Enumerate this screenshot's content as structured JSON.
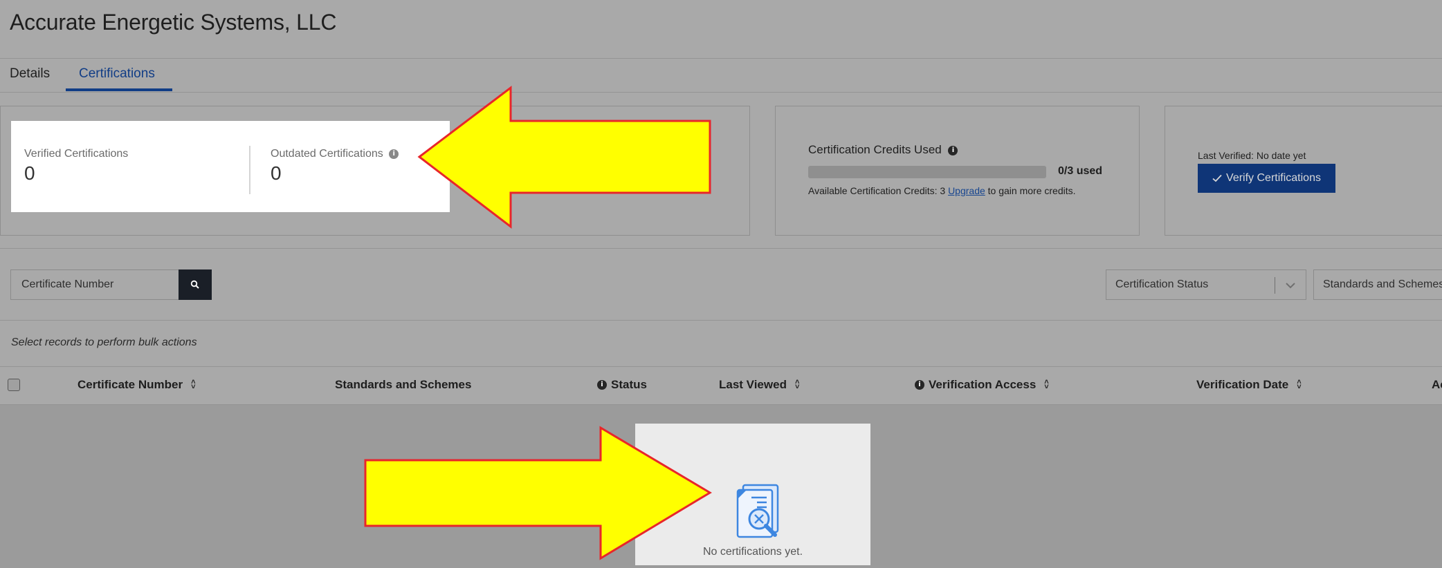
{
  "page": {
    "title": "Accurate Energetic Systems, LLC"
  },
  "tabs": [
    {
      "label": "Details",
      "active": false
    },
    {
      "label": "Certifications",
      "active": true
    }
  ],
  "stats": {
    "verified_label": "Verified Certifications",
    "verified_value": "0",
    "outdated_label": "Outdated Certifications",
    "outdated_value": "0"
  },
  "credits": {
    "title": "Certification Credits Used",
    "used_text": "0/3 used",
    "progress": 0,
    "available_prefix": "Available Certification Credits: 3 ",
    "upgrade_link": "Upgrade",
    "available_suffix": " to gain more credits."
  },
  "verify": {
    "last_verified": "Last Verified: No date yet",
    "button_label": "Verify Certifications",
    "button_icon": "check-icon"
  },
  "search": {
    "placeholder": "Certificate Number",
    "button_icon": "search-icon"
  },
  "filters": {
    "status_placeholder": "Certification Status",
    "standards_placeholder": "Standards and Schemes"
  },
  "bulk_hint": "Select records to perform bulk actions",
  "table": {
    "columns": [
      {
        "label": "Certificate Number",
        "sortable": true,
        "info": false
      },
      {
        "label": "Standards and Schemes",
        "sortable": false,
        "info": false
      },
      {
        "label": "Status",
        "sortable": false,
        "info": true
      },
      {
        "label": "Last Viewed",
        "sortable": true,
        "info": false
      },
      {
        "label": "Verification Access",
        "sortable": true,
        "info": true
      },
      {
        "label": "Verification Date",
        "sortable": true,
        "info": false
      },
      {
        "label": "Ac",
        "sortable": false,
        "info": false
      }
    ],
    "empty_text": "No certifications yet."
  },
  "colors": {
    "accent": "#113d86",
    "button": "#0f3577",
    "annotation_arrow_fill": "#ffff00",
    "annotation_arrow_stroke": "#e8262a"
  }
}
